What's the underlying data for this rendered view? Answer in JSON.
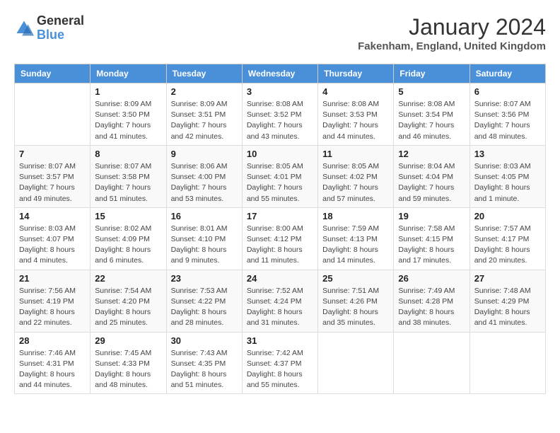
{
  "header": {
    "logo_line1": "General",
    "logo_line2": "Blue",
    "month_year": "January 2024",
    "location": "Fakenham, England, United Kingdom"
  },
  "days_of_week": [
    "Sunday",
    "Monday",
    "Tuesday",
    "Wednesday",
    "Thursday",
    "Friday",
    "Saturday"
  ],
  "weeks": [
    [
      {
        "day": "",
        "sunrise": "",
        "sunset": "",
        "daylight": ""
      },
      {
        "day": "1",
        "sunrise": "Sunrise: 8:09 AM",
        "sunset": "Sunset: 3:50 PM",
        "daylight": "Daylight: 7 hours and 41 minutes."
      },
      {
        "day": "2",
        "sunrise": "Sunrise: 8:09 AM",
        "sunset": "Sunset: 3:51 PM",
        "daylight": "Daylight: 7 hours and 42 minutes."
      },
      {
        "day": "3",
        "sunrise": "Sunrise: 8:08 AM",
        "sunset": "Sunset: 3:52 PM",
        "daylight": "Daylight: 7 hours and 43 minutes."
      },
      {
        "day": "4",
        "sunrise": "Sunrise: 8:08 AM",
        "sunset": "Sunset: 3:53 PM",
        "daylight": "Daylight: 7 hours and 44 minutes."
      },
      {
        "day": "5",
        "sunrise": "Sunrise: 8:08 AM",
        "sunset": "Sunset: 3:54 PM",
        "daylight": "Daylight: 7 hours and 46 minutes."
      },
      {
        "day": "6",
        "sunrise": "Sunrise: 8:07 AM",
        "sunset": "Sunset: 3:56 PM",
        "daylight": "Daylight: 7 hours and 48 minutes."
      }
    ],
    [
      {
        "day": "7",
        "sunrise": "Sunrise: 8:07 AM",
        "sunset": "Sunset: 3:57 PM",
        "daylight": "Daylight: 7 hours and 49 minutes."
      },
      {
        "day": "8",
        "sunrise": "Sunrise: 8:07 AM",
        "sunset": "Sunset: 3:58 PM",
        "daylight": "Daylight: 7 hours and 51 minutes."
      },
      {
        "day": "9",
        "sunrise": "Sunrise: 8:06 AM",
        "sunset": "Sunset: 4:00 PM",
        "daylight": "Daylight: 7 hours and 53 minutes."
      },
      {
        "day": "10",
        "sunrise": "Sunrise: 8:05 AM",
        "sunset": "Sunset: 4:01 PM",
        "daylight": "Daylight: 7 hours and 55 minutes."
      },
      {
        "day": "11",
        "sunrise": "Sunrise: 8:05 AM",
        "sunset": "Sunset: 4:02 PM",
        "daylight": "Daylight: 7 hours and 57 minutes."
      },
      {
        "day": "12",
        "sunrise": "Sunrise: 8:04 AM",
        "sunset": "Sunset: 4:04 PM",
        "daylight": "Daylight: 7 hours and 59 minutes."
      },
      {
        "day": "13",
        "sunrise": "Sunrise: 8:03 AM",
        "sunset": "Sunset: 4:05 PM",
        "daylight": "Daylight: 8 hours and 1 minute."
      }
    ],
    [
      {
        "day": "14",
        "sunrise": "Sunrise: 8:03 AM",
        "sunset": "Sunset: 4:07 PM",
        "daylight": "Daylight: 8 hours and 4 minutes."
      },
      {
        "day": "15",
        "sunrise": "Sunrise: 8:02 AM",
        "sunset": "Sunset: 4:09 PM",
        "daylight": "Daylight: 8 hours and 6 minutes."
      },
      {
        "day": "16",
        "sunrise": "Sunrise: 8:01 AM",
        "sunset": "Sunset: 4:10 PM",
        "daylight": "Daylight: 8 hours and 9 minutes."
      },
      {
        "day": "17",
        "sunrise": "Sunrise: 8:00 AM",
        "sunset": "Sunset: 4:12 PM",
        "daylight": "Daylight: 8 hours and 11 minutes."
      },
      {
        "day": "18",
        "sunrise": "Sunrise: 7:59 AM",
        "sunset": "Sunset: 4:13 PM",
        "daylight": "Daylight: 8 hours and 14 minutes."
      },
      {
        "day": "19",
        "sunrise": "Sunrise: 7:58 AM",
        "sunset": "Sunset: 4:15 PM",
        "daylight": "Daylight: 8 hours and 17 minutes."
      },
      {
        "day": "20",
        "sunrise": "Sunrise: 7:57 AM",
        "sunset": "Sunset: 4:17 PM",
        "daylight": "Daylight: 8 hours and 20 minutes."
      }
    ],
    [
      {
        "day": "21",
        "sunrise": "Sunrise: 7:56 AM",
        "sunset": "Sunset: 4:19 PM",
        "daylight": "Daylight: 8 hours and 22 minutes."
      },
      {
        "day": "22",
        "sunrise": "Sunrise: 7:54 AM",
        "sunset": "Sunset: 4:20 PM",
        "daylight": "Daylight: 8 hours and 25 minutes."
      },
      {
        "day": "23",
        "sunrise": "Sunrise: 7:53 AM",
        "sunset": "Sunset: 4:22 PM",
        "daylight": "Daylight: 8 hours and 28 minutes."
      },
      {
        "day": "24",
        "sunrise": "Sunrise: 7:52 AM",
        "sunset": "Sunset: 4:24 PM",
        "daylight": "Daylight: 8 hours and 31 minutes."
      },
      {
        "day": "25",
        "sunrise": "Sunrise: 7:51 AM",
        "sunset": "Sunset: 4:26 PM",
        "daylight": "Daylight: 8 hours and 35 minutes."
      },
      {
        "day": "26",
        "sunrise": "Sunrise: 7:49 AM",
        "sunset": "Sunset: 4:28 PM",
        "daylight": "Daylight: 8 hours and 38 minutes."
      },
      {
        "day": "27",
        "sunrise": "Sunrise: 7:48 AM",
        "sunset": "Sunset: 4:29 PM",
        "daylight": "Daylight: 8 hours and 41 minutes."
      }
    ],
    [
      {
        "day": "28",
        "sunrise": "Sunrise: 7:46 AM",
        "sunset": "Sunset: 4:31 PM",
        "daylight": "Daylight: 8 hours and 44 minutes."
      },
      {
        "day": "29",
        "sunrise": "Sunrise: 7:45 AM",
        "sunset": "Sunset: 4:33 PM",
        "daylight": "Daylight: 8 hours and 48 minutes."
      },
      {
        "day": "30",
        "sunrise": "Sunrise: 7:43 AM",
        "sunset": "Sunset: 4:35 PM",
        "daylight": "Daylight: 8 hours and 51 minutes."
      },
      {
        "day": "31",
        "sunrise": "Sunrise: 7:42 AM",
        "sunset": "Sunset: 4:37 PM",
        "daylight": "Daylight: 8 hours and 55 minutes."
      },
      {
        "day": "",
        "sunrise": "",
        "sunset": "",
        "daylight": ""
      },
      {
        "day": "",
        "sunrise": "",
        "sunset": "",
        "daylight": ""
      },
      {
        "day": "",
        "sunrise": "",
        "sunset": "",
        "daylight": ""
      }
    ]
  ]
}
